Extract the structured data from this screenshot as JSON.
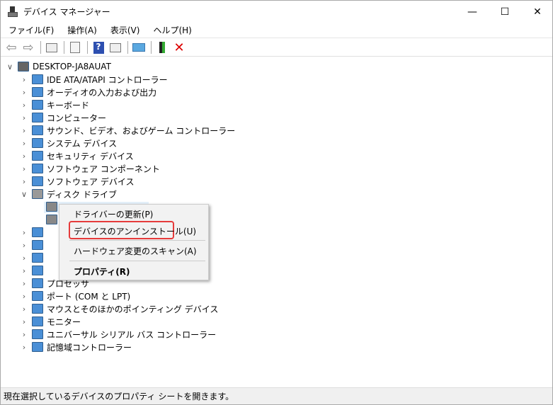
{
  "window": {
    "title": "デバイス マネージャー",
    "minimize": "—",
    "maximize": "☐",
    "close": "✕"
  },
  "menu": [
    "ファイル(F)",
    "操作(A)",
    "表示(V)",
    "ヘルプ(H)"
  ],
  "toolbar": [
    "back-icon",
    "forward-icon",
    "show-hide-console-tree-icon",
    "properties-icon",
    "help-icon",
    "action-pane-icon",
    "scan-hardware-icon",
    "update-driver-icon",
    "uninstall-icon"
  ],
  "tree": {
    "root": "DESKTOP-JA8AUAT",
    "items": [
      "IDE ATA/ATAPI コントローラー",
      "オーディオの入力および出力",
      "キーボード",
      "コンピューター",
      "サウンド、ビデオ、およびゲーム コントローラー",
      "システム デバイス",
      "セキュリティ デバイス",
      "ソフトウェア コンポーネント",
      "ソフトウェア デバイス",
      "ディスク ドライブ"
    ],
    "items_after": [
      "プロセッサ",
      "ポート (COM と LPT)",
      "マウスとそのほかのポインティング デバイス",
      "モニター",
      "ユニバーサル シリアル バス コントローラー",
      "記憶域コントローラー"
    ]
  },
  "context_menu": {
    "update_driver": "ドライバーの更新(P)",
    "uninstall": "デバイスのアンインストール(U)",
    "scan": "ハードウェア変更のスキャン(A)",
    "properties": "プロパティ(R)"
  },
  "status": "現在選択しているデバイスのプロパティ シートを開きます。",
  "colors": {
    "highlight": "#e63b3b",
    "selection": "#e5f1fb"
  }
}
